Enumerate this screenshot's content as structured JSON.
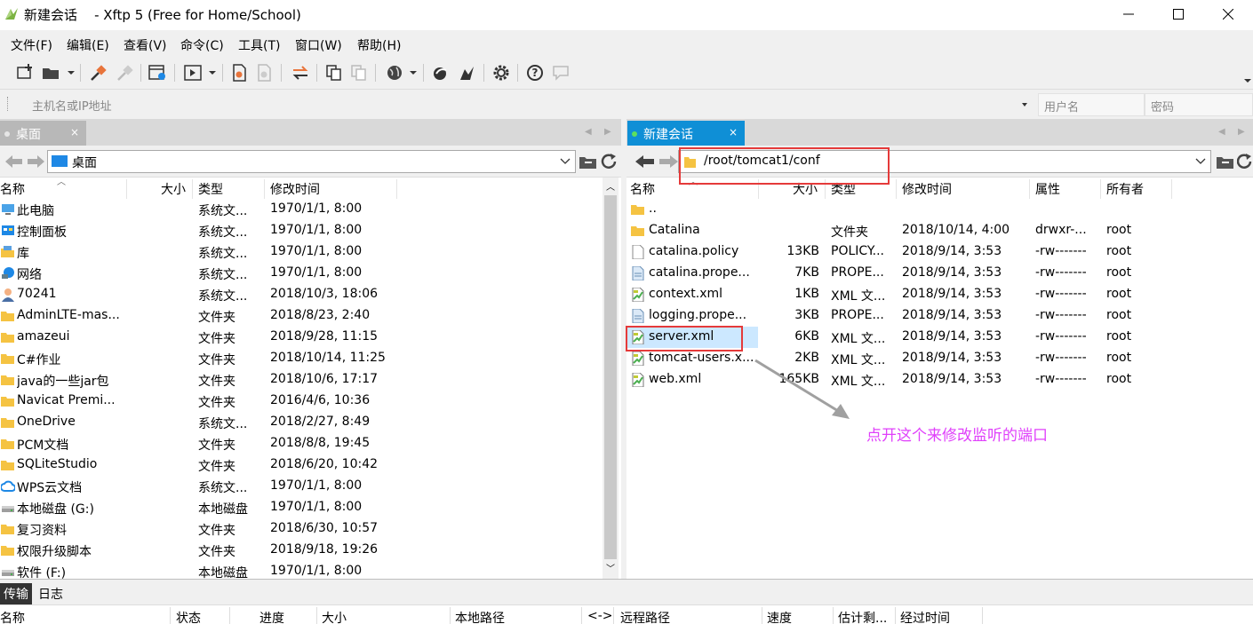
{
  "window": {
    "title": "新建会话    - Xftp 5 (Free for Home/School)"
  },
  "menu": [
    "文件(F)",
    "编辑(E)",
    "查看(V)",
    "命令(C)",
    "工具(T)",
    "窗口(W)",
    "帮助(H)"
  ],
  "address": {
    "host_placeholder": "主机名或IP地址",
    "user_placeholder": "用户名",
    "password_placeholder": "密码"
  },
  "left_pane": {
    "tab_label": "桌面",
    "path": "桌面",
    "columns": [
      "名称",
      "大小",
      "类型",
      "修改时间"
    ],
    "rows": [
      {
        "name": "此电脑",
        "size": "",
        "type": "系统文...",
        "modified": "1970/1/1, 8:00",
        "icon": "computer-icon"
      },
      {
        "name": "控制面板",
        "size": "",
        "type": "系统文...",
        "modified": "1970/1/1, 8:00",
        "icon": "control-panel-icon"
      },
      {
        "name": "库",
        "size": "",
        "type": "系统文...",
        "modified": "1970/1/1, 8:00",
        "icon": "library-icon"
      },
      {
        "name": "网络",
        "size": "",
        "type": "系统文...",
        "modified": "1970/1/1, 8:00",
        "icon": "network-icon"
      },
      {
        "name": "70241",
        "size": "",
        "type": "系统文...",
        "modified": "2018/10/3, 18:06",
        "icon": "user-icon"
      },
      {
        "name": "AdminLTE-mas...",
        "size": "",
        "type": "文件夹",
        "modified": "2018/8/23, 2:40",
        "icon": "folder-icon"
      },
      {
        "name": "amazeui",
        "size": "",
        "type": "文件夹",
        "modified": "2018/9/28, 11:15",
        "icon": "folder-icon"
      },
      {
        "name": "C#作业",
        "size": "",
        "type": "文件夹",
        "modified": "2018/10/14, 11:25",
        "icon": "folder-icon"
      },
      {
        "name": "java的一些jar包",
        "size": "",
        "type": "文件夹",
        "modified": "2018/10/6, 17:17",
        "icon": "folder-icon"
      },
      {
        "name": "Navicat Premi...",
        "size": "",
        "type": "文件夹",
        "modified": "2016/4/6, 10:36",
        "icon": "folder-icon"
      },
      {
        "name": "OneDrive",
        "size": "",
        "type": "系统文...",
        "modified": "2018/2/27, 8:49",
        "icon": "folder-icon"
      },
      {
        "name": "PCM文档",
        "size": "",
        "type": "文件夹",
        "modified": "2018/8/8, 19:45",
        "icon": "folder-icon"
      },
      {
        "name": "SQLiteStudio",
        "size": "",
        "type": "文件夹",
        "modified": "2018/6/20, 10:42",
        "icon": "folder-icon"
      },
      {
        "name": "WPS云文档",
        "size": "",
        "type": "系统文...",
        "modified": "1970/1/1, 8:00",
        "icon": "cloud-icon"
      },
      {
        "name": "本地磁盘 (G:)",
        "size": "",
        "type": "本地磁盘",
        "modified": "1970/1/1, 8:00",
        "icon": "disk-icon"
      },
      {
        "name": "复习资料",
        "size": "",
        "type": "文件夹",
        "modified": "2018/6/30, 10:57",
        "icon": "folder-icon"
      },
      {
        "name": "权限升级脚本",
        "size": "",
        "type": "文件夹",
        "modified": "2018/9/18, 19:26",
        "icon": "folder-icon"
      },
      {
        "name": "软件 (F:)",
        "size": "",
        "type": "本地磁盘",
        "modified": "1970/1/1, 8:00",
        "icon": "disk-icon"
      }
    ]
  },
  "right_pane": {
    "tab_label": "新建会话",
    "path": "/root/tomcat1/conf",
    "columns": [
      "名称",
      "大小",
      "类型",
      "修改时间",
      "属性",
      "所有者"
    ],
    "rows": [
      {
        "name": "..",
        "size": "",
        "type": "",
        "modified": "",
        "attr": "",
        "owner": "",
        "icon": "folder-icon"
      },
      {
        "name": "Catalina",
        "size": "",
        "type": "文件夹",
        "modified": "2018/10/14, 4:00",
        "attr": "drwxr-...",
        "owner": "root",
        "icon": "folder-icon"
      },
      {
        "name": "catalina.policy",
        "size": "13KB",
        "type": "POLICY...",
        "modified": "2018/9/14, 3:53",
        "attr": "-rw-------",
        "owner": "root",
        "icon": "file-icon"
      },
      {
        "name": "catalina.prope...",
        "size": "7KB",
        "type": "PROPE...",
        "modified": "2018/9/14, 3:53",
        "attr": "-rw-------",
        "owner": "root",
        "icon": "properties-file-icon"
      },
      {
        "name": "context.xml",
        "size": "1KB",
        "type": "XML 文...",
        "modified": "2018/9/14, 3:53",
        "attr": "-rw-------",
        "owner": "root",
        "icon": "xml-file-icon"
      },
      {
        "name": "logging.prope...",
        "size": "3KB",
        "type": "PROPE...",
        "modified": "2018/9/14, 3:53",
        "attr": "-rw-------",
        "owner": "root",
        "icon": "properties-file-icon"
      },
      {
        "name": "server.xml",
        "size": "6KB",
        "type": "XML 文...",
        "modified": "2018/9/14, 3:53",
        "attr": "-rw-------",
        "owner": "root",
        "icon": "xml-file-icon"
      },
      {
        "name": "tomcat-users.x...",
        "size": "2KB",
        "type": "XML 文...",
        "modified": "2018/9/14, 3:53",
        "attr": "-rw-------",
        "owner": "root",
        "icon": "xml-file-icon"
      },
      {
        "name": "web.xml",
        "size": "165KB",
        "type": "XML 文...",
        "modified": "2018/9/14, 3:53",
        "attr": "-rw-------",
        "owner": "root",
        "icon": "xml-file-icon"
      }
    ],
    "selected_index": 6
  },
  "transfer": {
    "tabs": [
      "传输",
      "日志"
    ],
    "columns": [
      "名称",
      "状态",
      "进度",
      "大小",
      "本地路径",
      "<->",
      "远程路径",
      "速度",
      "估计剩...",
      "经过时间"
    ]
  },
  "annotation": {
    "text": "点开这个来修改监听的端口",
    "color": "#e040fb",
    "box_color": "#e53a3a"
  },
  "colors": {
    "folder": "#f5c342",
    "session_tab": "#0f8fd6",
    "selected_row": "#cce8ff"
  }
}
